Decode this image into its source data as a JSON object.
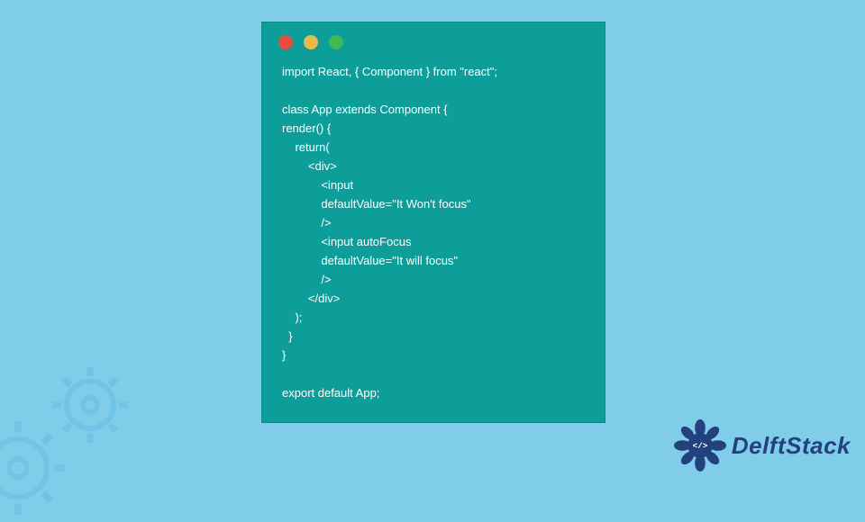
{
  "window": {
    "dots": {
      "red": "#e94b3c",
      "yellow": "#e9b949",
      "green": "#3fb950"
    }
  },
  "code": {
    "lines": [
      "import React, { Component } from \"react\";",
      "",
      "class App extends Component {",
      "render() {",
      "    return(",
      "        <div>",
      "            <input",
      "            defaultValue=\"It Won't focus\"",
      "            />",
      "            <input autoFocus",
      "            defaultValue=\"It will focus\"",
      "            />",
      "        </div>",
      "    );",
      "  }",
      "}",
      "",
      "export default App;"
    ]
  },
  "brand": {
    "name": "DelftStack",
    "accent": "#22417d"
  }
}
